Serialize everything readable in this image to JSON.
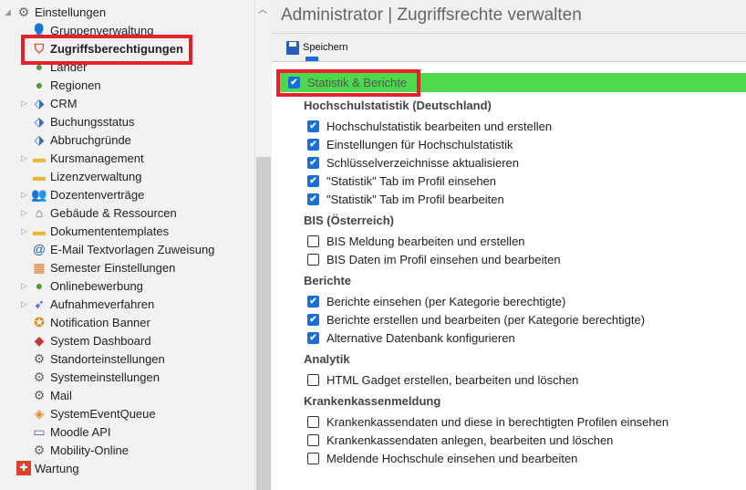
{
  "sidebar": {
    "items": [
      {
        "label": "Einstellungen",
        "icon": "gear-icon",
        "level": 0,
        "expanded": true
      },
      {
        "label": "Gruppenverwaltung",
        "icon": "users-icon",
        "level": 1
      },
      {
        "label": "Zugriffsberechtigungen",
        "icon": "shield-icon",
        "level": 1,
        "selected": true
      },
      {
        "label": "Länder",
        "icon": "globe-icon",
        "level": 1
      },
      {
        "label": "Regionen",
        "icon": "globe-network-icon",
        "level": 1
      },
      {
        "label": "CRM",
        "icon": "tag-icon",
        "level": 1,
        "expandable": true
      },
      {
        "label": "Buchungsstatus",
        "icon": "tag-icon",
        "level": 1
      },
      {
        "label": "Abbruchgründe",
        "icon": "tag-icon",
        "level": 1
      },
      {
        "label": "Kursmanagement",
        "icon": "folder-icon",
        "level": 1,
        "expandable": true
      },
      {
        "label": "Lizenzverwaltung",
        "icon": "folder-icon",
        "level": 1
      },
      {
        "label": "Dozentenverträge",
        "icon": "people-icon",
        "level": 1,
        "expandable": true
      },
      {
        "label": "Gebäude & Ressourcen",
        "icon": "house-icon",
        "level": 1,
        "expandable": true
      },
      {
        "label": "Dokumententemplates",
        "icon": "folder-icon",
        "level": 1,
        "expandable": true
      },
      {
        "label": "E-Mail Textvorlagen Zuweisung",
        "icon": "at-icon",
        "level": 1
      },
      {
        "label": "Semester Einstellungen",
        "icon": "calendar-icon",
        "level": 1
      },
      {
        "label": "Onlinebewerbung",
        "icon": "globe-icon",
        "level": 1,
        "expandable": true
      },
      {
        "label": "Aufnahmeverfahren",
        "icon": "bird-icon",
        "level": 1,
        "expandable": true
      },
      {
        "label": "Notification Banner",
        "icon": "badge-icon",
        "level": 1
      },
      {
        "label": "System Dashboard",
        "icon": "dashboard-icon",
        "level": 1
      },
      {
        "label": "Standorteinstellungen",
        "icon": "gear-icon",
        "level": 1
      },
      {
        "label": "Systemeinstellungen",
        "icon": "gear-icon",
        "level": 1
      },
      {
        "label": "Mail",
        "icon": "gear-icon",
        "level": 1
      },
      {
        "label": "SystemEventQueue",
        "icon": "ticket-icon",
        "level": 1
      },
      {
        "label": "Moodle API",
        "icon": "window-link-icon",
        "level": 1
      },
      {
        "label": "Mobility-Online",
        "icon": "gear-icon",
        "level": 1
      },
      {
        "label": "Wartung",
        "icon": "first-aid-icon",
        "level": 0
      }
    ]
  },
  "main": {
    "title": "Administrator | Zugriffsrechte verwalten",
    "toolbar": {
      "save_label": "Speichern"
    },
    "category": {
      "label": "Statistik & Berichte",
      "checked": true,
      "highlight": "#4cd94c"
    },
    "sections": [
      {
        "title": "Hochschulstatistik (Deutschland)",
        "perms": [
          {
            "label": "Hochschulstatistik bearbeiten und erstellen",
            "checked": true
          },
          {
            "label": "Einstellungen für Hochschulstatistik",
            "checked": true
          },
          {
            "label": "Schlüsselverzeichnisse aktualisieren",
            "checked": true
          },
          {
            "label": "\"Statistik\" Tab im Profil einsehen",
            "checked": true
          },
          {
            "label": "\"Statistik\" Tab im Profil bearbeiten",
            "checked": true
          }
        ]
      },
      {
        "title": "BIS (Österreich)",
        "perms": [
          {
            "label": "BIS Meldung bearbeiten und erstellen",
            "checked": false
          },
          {
            "label": "BIS Daten im Profil einsehen und bearbeiten",
            "checked": false
          }
        ]
      },
      {
        "title": "Berichte",
        "perms": [
          {
            "label": "Berichte einsehen (per Kategorie berechtigte)",
            "checked": true
          },
          {
            "label": "Berichte erstellen und bearbeiten (per Kategorie berechtigte)",
            "checked": true
          },
          {
            "label": "Alternative Datenbank konfigurieren",
            "checked": true
          }
        ]
      },
      {
        "title": "Analytik",
        "perms": [
          {
            "label": "HTML Gadget erstellen, bearbeiten und löschen",
            "checked": false
          }
        ]
      },
      {
        "title": "Krankenkassenmeldung",
        "perms": [
          {
            "label": "Krankenkassendaten und diese in berechtigten Profilen einsehen",
            "checked": false
          },
          {
            "label": "Krankenkassendaten anlegen, bearbeiten und löschen",
            "checked": false
          },
          {
            "label": "Meldende Hochschule einsehen und bearbeiten",
            "checked": false
          }
        ]
      }
    ]
  }
}
